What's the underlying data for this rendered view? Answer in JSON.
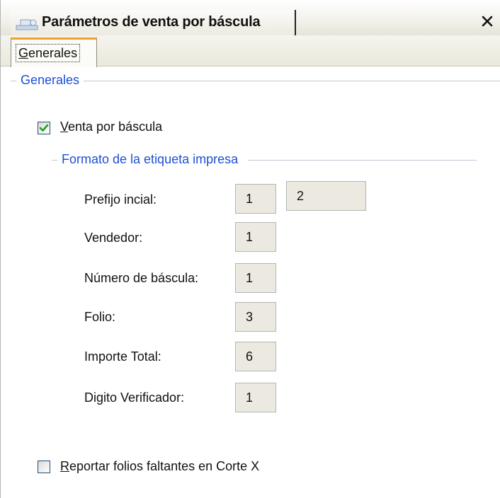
{
  "window": {
    "title": "Parámetros de venta por báscula",
    "close_glyph": "✕"
  },
  "tabs": [
    {
      "label_first": "G",
      "label_rest": "enerales",
      "selected": true
    }
  ],
  "general_group": {
    "title": "Generales"
  },
  "venta_checkbox": {
    "checked": true,
    "label_first": "V",
    "label_rest": "enta por báscula"
  },
  "format_group": {
    "title": "Formato de la etiqueta impresa",
    "fields": [
      {
        "label": "Prefijo incial:",
        "value": "1",
        "value2": "2"
      },
      {
        "label": "Vendedor:",
        "value": "1"
      },
      {
        "label": "Número de báscula:",
        "value": "1"
      },
      {
        "label": "Folio:",
        "value": "3"
      },
      {
        "label": "Importe Total:",
        "value": "6"
      },
      {
        "label": "Digito Verificador:",
        "value": "1"
      }
    ]
  },
  "reportar_checkbox": {
    "checked": false,
    "label_first": "R",
    "label_rest": "eportar folios faltantes en Corte X"
  },
  "colors": {
    "accent_blue": "#1e4fd4",
    "tab_highlight": "#f0a030",
    "field_bg": "#eceae0",
    "check_green": "#21a121"
  }
}
